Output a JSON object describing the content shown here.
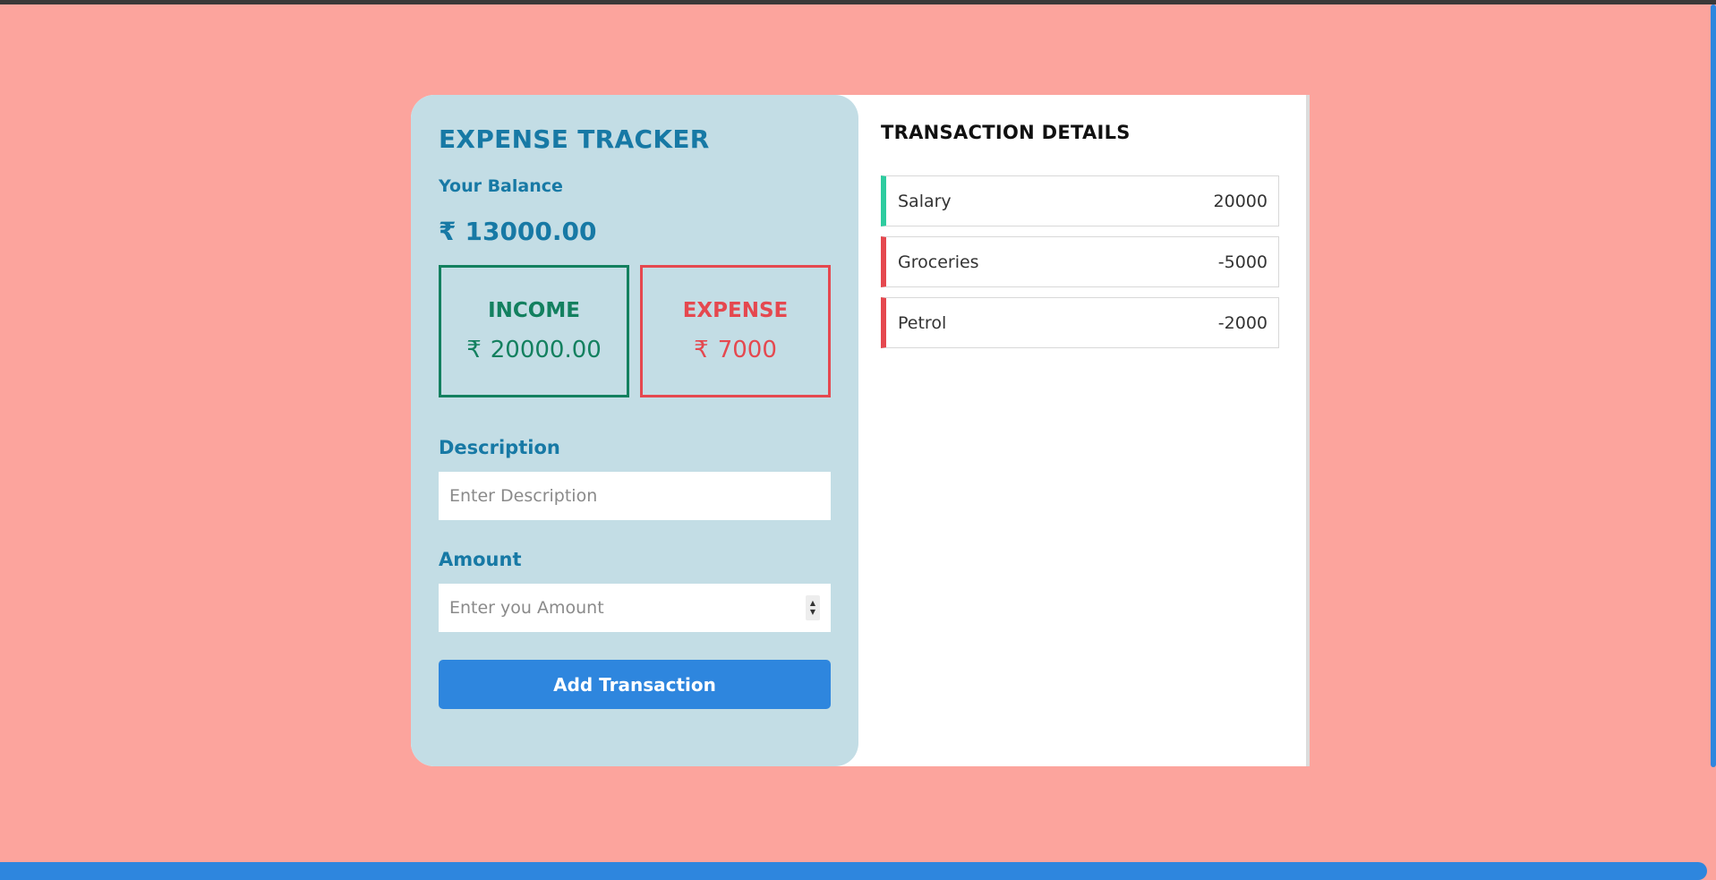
{
  "app": {
    "title": "EXPENSE TRACKER",
    "balance_label": "Your Balance",
    "currency_symbol": "₹",
    "balance_value": "13000.00"
  },
  "summary": {
    "income_title": "INCOME",
    "income_value": "20000.00",
    "expense_title": "EXPENSE",
    "expense_value": "7000"
  },
  "form": {
    "description_label": "Description",
    "description_placeholder": "Enter Description",
    "amount_label": "Amount",
    "amount_placeholder": "Enter you Amount",
    "submit_label": "Add Transaction"
  },
  "transactions": {
    "title": "TRANSACTION DETAILS",
    "items": [
      {
        "name": "Salary",
        "amount": "20000",
        "type": "income"
      },
      {
        "name": "Groceries",
        "amount": "-5000",
        "type": "expense"
      },
      {
        "name": "Petrol",
        "amount": "-2000",
        "type": "expense"
      }
    ]
  },
  "colors": {
    "page_background": "#fca49d",
    "panel_background": "#c3dde5",
    "accent_blue": "#2e86de",
    "income_green": "#13805f",
    "expense_red": "#e5484f",
    "income_marker": "#2ecc9f"
  },
  "icons": {
    "currency": "rupee-sign-icon",
    "stepper": "spinner-arrows-icon"
  }
}
